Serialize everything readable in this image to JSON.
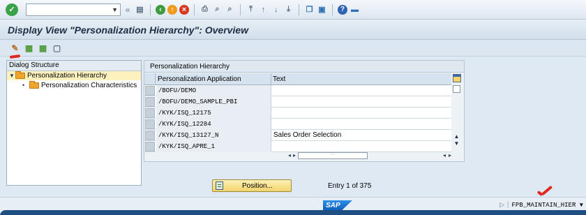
{
  "toolbar": {
    "command_value": "",
    "command_placeholder": ""
  },
  "title": "Display View \"Personalization Hierarchy\": Overview",
  "dialog_structure": {
    "heading": "Dialog Structure",
    "items": [
      {
        "label": "Personalization Hierarchy",
        "selected": true,
        "expanded": true
      },
      {
        "label": "Personalization Characteristics",
        "selected": false
      }
    ]
  },
  "table": {
    "title": "Personalization Hierarchy",
    "columns": [
      "Personalization Application",
      "Text"
    ],
    "rows": [
      {
        "app": "/BOFU/DEMO",
        "text": ""
      },
      {
        "app": "/BOFU/DEMO_SAMPLE_PBI",
        "text": ""
      },
      {
        "app": "/KYK/ISQ_12175",
        "text": ""
      },
      {
        "app": "/KYK/ISQ_12284",
        "text": ""
      },
      {
        "app": "/KYK/ISQ_13127_N",
        "text": "Sales Order Selection"
      },
      {
        "app": "/KYK/ISQ_APRE_1",
        "text": ""
      }
    ]
  },
  "position_button": "Position...",
  "entry_info": "Entry 1 of 375",
  "status": {
    "sap_logo": "SAP",
    "transaction": "FPB_MAINTAIN_HIER"
  },
  "colors": {
    "selected_row": "#fdf2bd",
    "brand_blue": "#1f4f82",
    "annotation_red": "#e0281f"
  }
}
